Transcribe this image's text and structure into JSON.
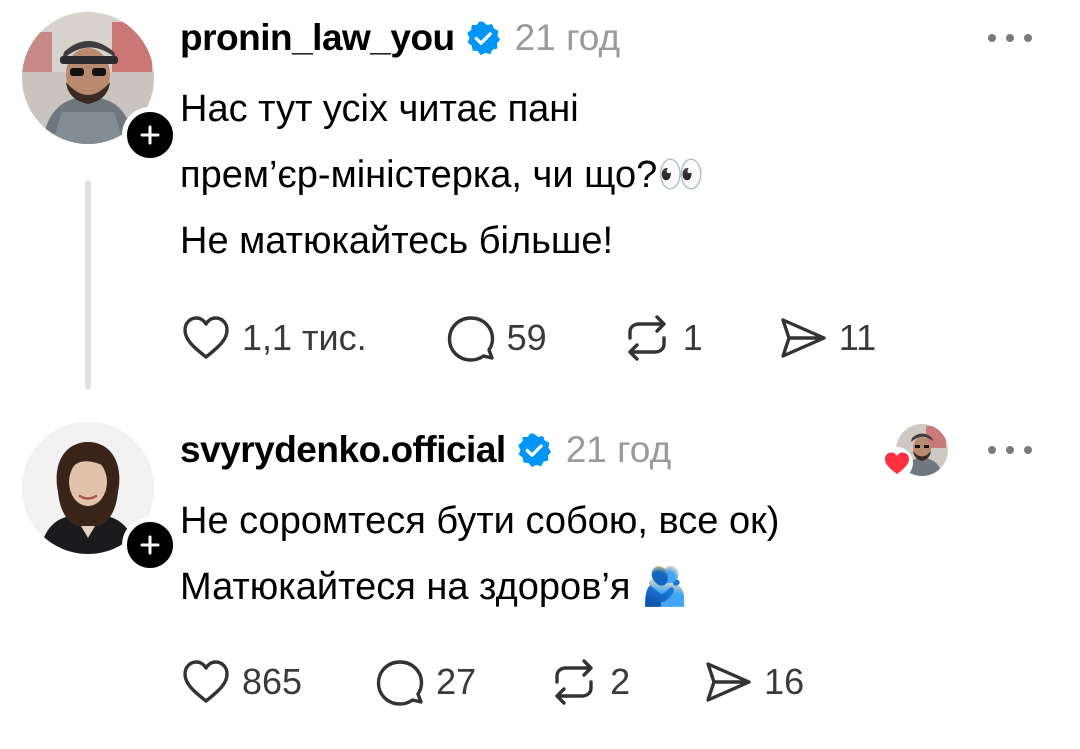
{
  "posts": [
    {
      "username": "pronin_law_you",
      "time": "21 год",
      "lines": [
        "Нас тут усіх читає пані",
        "прем’єр-міністерка, чи що?👀",
        "Не матюкайтесь більше!"
      ],
      "likes": "1,1 тис.",
      "comments": "59",
      "reposts": "1",
      "shares": "11"
    },
    {
      "username": "svyrydenko.official",
      "time": "21 год",
      "lines": [
        "Не соромтеся бути собою, все ок)",
        "Матюкайтеся на здоров’я 🫂"
      ],
      "likes": "865",
      "comments": "27",
      "reposts": "2",
      "shares": "16"
    }
  ],
  "colors": {
    "verified": "#0095f6",
    "heart": "#ff3040",
    "muted_text": "#9a9a9a"
  }
}
